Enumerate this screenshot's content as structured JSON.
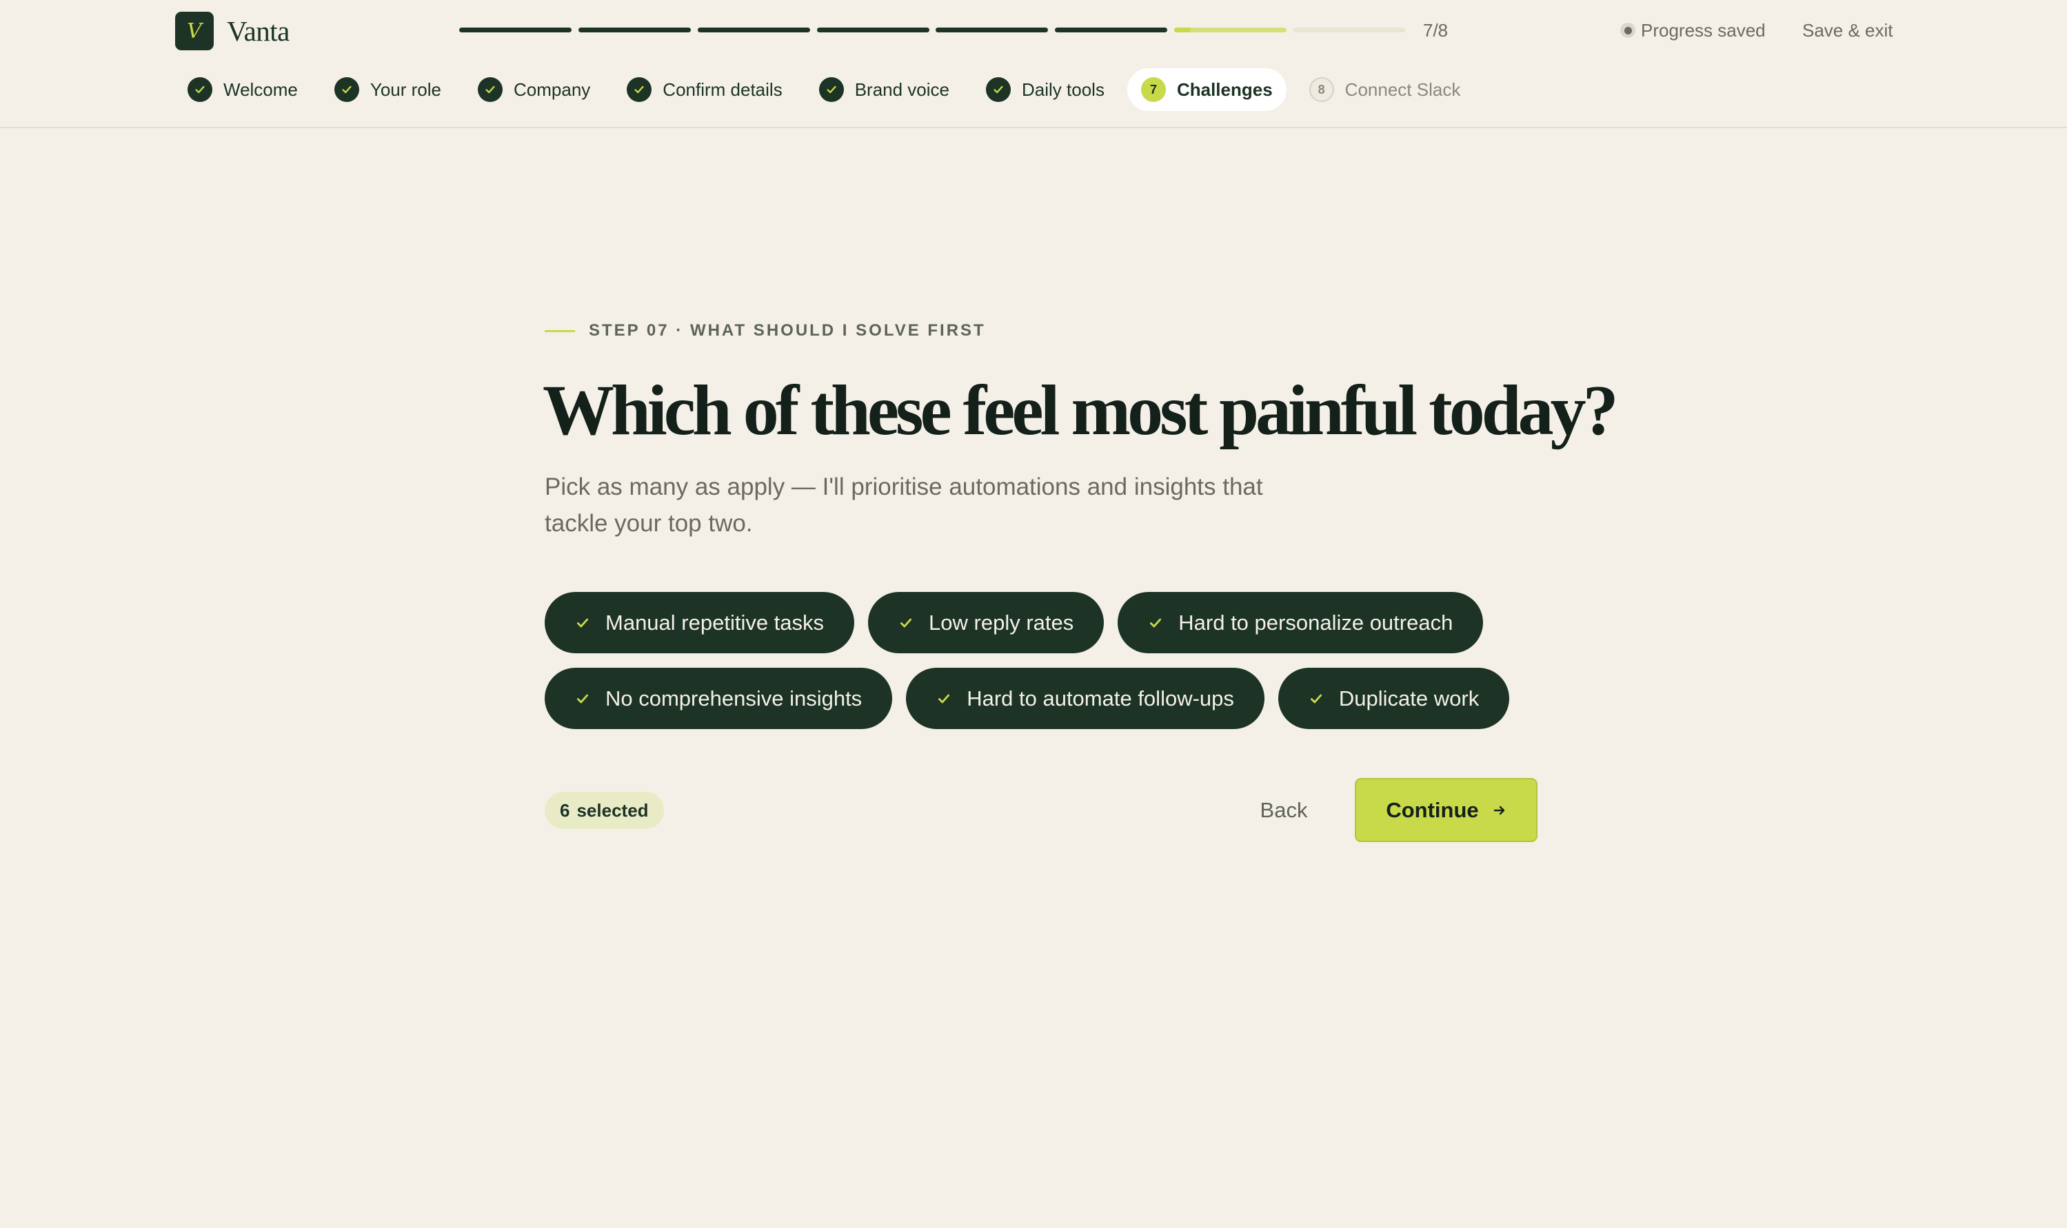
{
  "brand": {
    "logo_letter": "V",
    "name": "Vanta"
  },
  "progress": {
    "segments": [
      {
        "state": "done"
      },
      {
        "state": "done"
      },
      {
        "state": "done"
      },
      {
        "state": "done"
      },
      {
        "state": "done"
      },
      {
        "state": "done"
      },
      {
        "state": "current",
        "fill_fraction": 0.15
      },
      {
        "state": "todo"
      }
    ],
    "counter": "7/8"
  },
  "header_actions": {
    "saved_label": "Progress saved",
    "save_exit_label": "Save & exit"
  },
  "steps": [
    {
      "label": "Welcome",
      "state": "done"
    },
    {
      "label": "Your role",
      "state": "done"
    },
    {
      "label": "Company",
      "state": "done"
    },
    {
      "label": "Confirm details",
      "state": "done"
    },
    {
      "label": "Brand voice",
      "state": "done"
    },
    {
      "label": "Daily tools",
      "state": "done"
    },
    {
      "label": "Challenges",
      "state": "active",
      "number": "7"
    },
    {
      "label": "Connect Slack",
      "state": "todo",
      "number": "8"
    }
  ],
  "main": {
    "eyebrow": "STEP 07 · WHAT SHOULD I SOLVE FIRST",
    "title": "Which of these feel most painful today?",
    "subtitle": "Pick as many as apply — I'll prioritise automations and insights that tackle your top two.",
    "options": [
      {
        "label": "Manual repetitive tasks",
        "selected": true
      },
      {
        "label": "Low reply rates",
        "selected": true
      },
      {
        "label": "Hard to personalize outreach",
        "selected": true
      },
      {
        "label": "No comprehensive insights",
        "selected": true
      },
      {
        "label": "Hard to automate follow-ups",
        "selected": true
      },
      {
        "label": "Duplicate work",
        "selected": true
      }
    ],
    "selected_count": "6",
    "selected_label": "selected",
    "back_label": "Back",
    "continue_label": "Continue"
  },
  "colors": {
    "background": "#f4f0e8",
    "dark_green": "#1c3325",
    "lime": "#c8d94a",
    "muted_text": "#6b6a5e"
  },
  "icons": {
    "check": "check-icon",
    "arrow": "arrow-right-icon",
    "saved_indicator": "dot-icon"
  }
}
